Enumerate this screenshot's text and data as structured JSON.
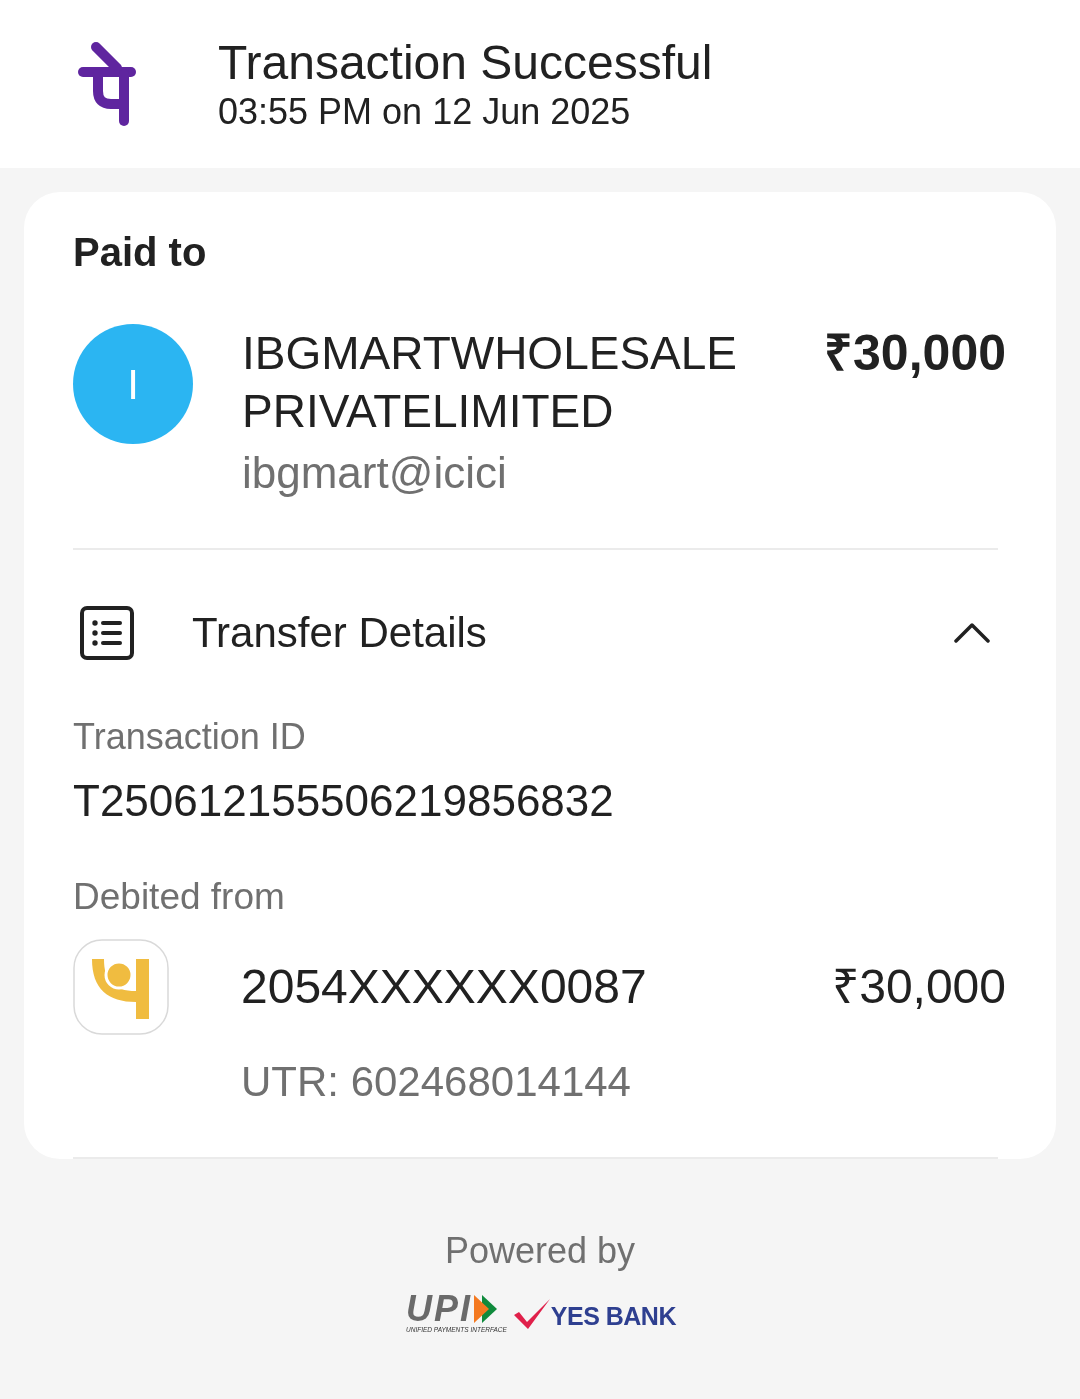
{
  "header": {
    "title": "Transaction Successful",
    "timestamp": "03:55 PM on 12 Jun 2025"
  },
  "paid_to": {
    "heading": "Paid to",
    "avatar_initial": "I",
    "name": "IBGMARTWHOLESALE PRIVATELIMITED",
    "upi_id": "ibgmart@icici",
    "amount": "₹30,000"
  },
  "transfer_details": {
    "title": "Transfer Details",
    "expanded": true,
    "transaction_id": {
      "label": "Transaction ID",
      "value": "T250612155506219856832"
    },
    "debited_from": {
      "label": "Debited from",
      "account": "2054XXXXXX0087",
      "amount": "₹30,000",
      "utr": "UTR: 602468014144"
    }
  },
  "footer": {
    "label": "Powered by",
    "upi_logo": {
      "text": "UPI",
      "tagline": "UNIFIED PAYMENTS INTERFACE"
    },
    "bank_logo": {
      "text": "YES BANK"
    }
  }
}
